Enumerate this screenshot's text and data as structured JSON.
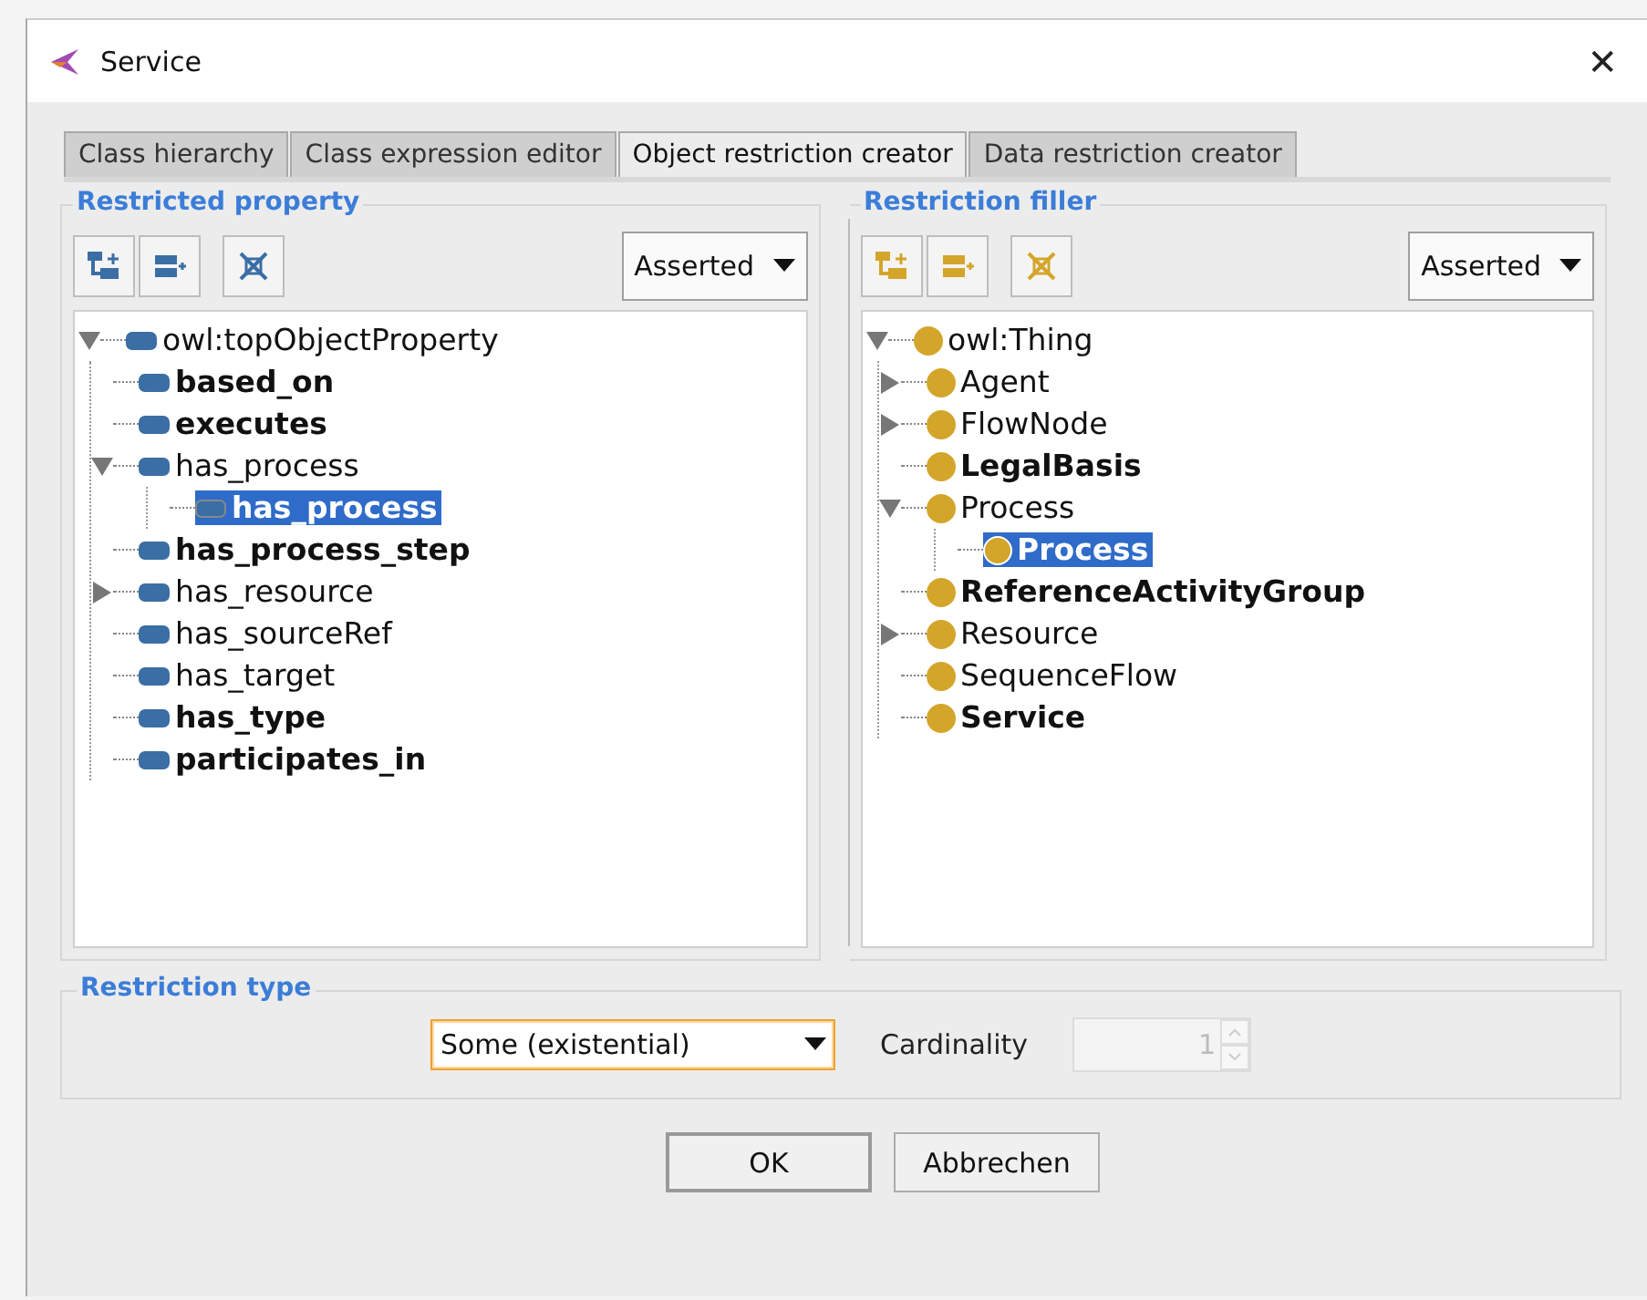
{
  "window": {
    "title": "Service",
    "close": "✕"
  },
  "tabs": [
    {
      "label": "Class hierarchy",
      "selected": false
    },
    {
      "label": "Class expression editor",
      "selected": false
    },
    {
      "label": "Object restriction creator",
      "selected": true
    },
    {
      "label": "Data restriction creator",
      "selected": false
    }
  ],
  "panels": [
    {
      "title": "Restricted property",
      "kind": "property",
      "mode": "Asserted",
      "tree": [
        {
          "label": "owl:topObjectProperty",
          "bold": false,
          "selected": false,
          "expanded": true,
          "children": [
            {
              "label": "based_on",
              "bold": true,
              "selected": false
            },
            {
              "label": "executes",
              "bold": true,
              "selected": false
            },
            {
              "label": "has_process",
              "bold": false,
              "selected": false,
              "expanded": true,
              "children": [
                {
                  "label": "has_process",
                  "bold": true,
                  "selected": true
                }
              ]
            },
            {
              "label": "has_process_step",
              "bold": true,
              "selected": false
            },
            {
              "label": "has_resource",
              "bold": false,
              "selected": false,
              "expanded": false
            },
            {
              "label": "has_sourceRef",
              "bold": false,
              "selected": false
            },
            {
              "label": "has_target",
              "bold": false,
              "selected": false
            },
            {
              "label": "has_type",
              "bold": true,
              "selected": false
            },
            {
              "label": "participates_in",
              "bold": true,
              "selected": false
            }
          ]
        }
      ]
    },
    {
      "title": "Restriction filler",
      "kind": "class",
      "mode": "Asserted",
      "tree": [
        {
          "label": "owl:Thing",
          "bold": false,
          "selected": false,
          "expanded": true,
          "children": [
            {
              "label": "Agent",
              "bold": false,
              "selected": false,
              "expanded": false
            },
            {
              "label": "FlowNode",
              "bold": false,
              "selected": false,
              "expanded": false
            },
            {
              "label": "LegalBasis",
              "bold": true,
              "selected": false
            },
            {
              "label": "Process",
              "bold": false,
              "selected": false,
              "expanded": true,
              "children": [
                {
                  "label": "Process",
                  "bold": true,
                  "selected": true
                }
              ]
            },
            {
              "label": "ReferenceActivityGroup",
              "bold": true,
              "selected": false
            },
            {
              "label": "Resource",
              "bold": false,
              "selected": false,
              "expanded": false
            },
            {
              "label": "SequenceFlow",
              "bold": false,
              "selected": false
            },
            {
              "label": "Service",
              "bold": true,
              "selected": false
            }
          ]
        }
      ]
    }
  ],
  "restriction_type": {
    "title": "Restriction type",
    "value": "Some (existential)",
    "cardinality_label": "Cardinality",
    "cardinality": "1",
    "cardinality_disabled": true
  },
  "buttons": [
    {
      "label": "OK",
      "default": true
    },
    {
      "label": "Abbrechen",
      "default": false
    }
  ]
}
